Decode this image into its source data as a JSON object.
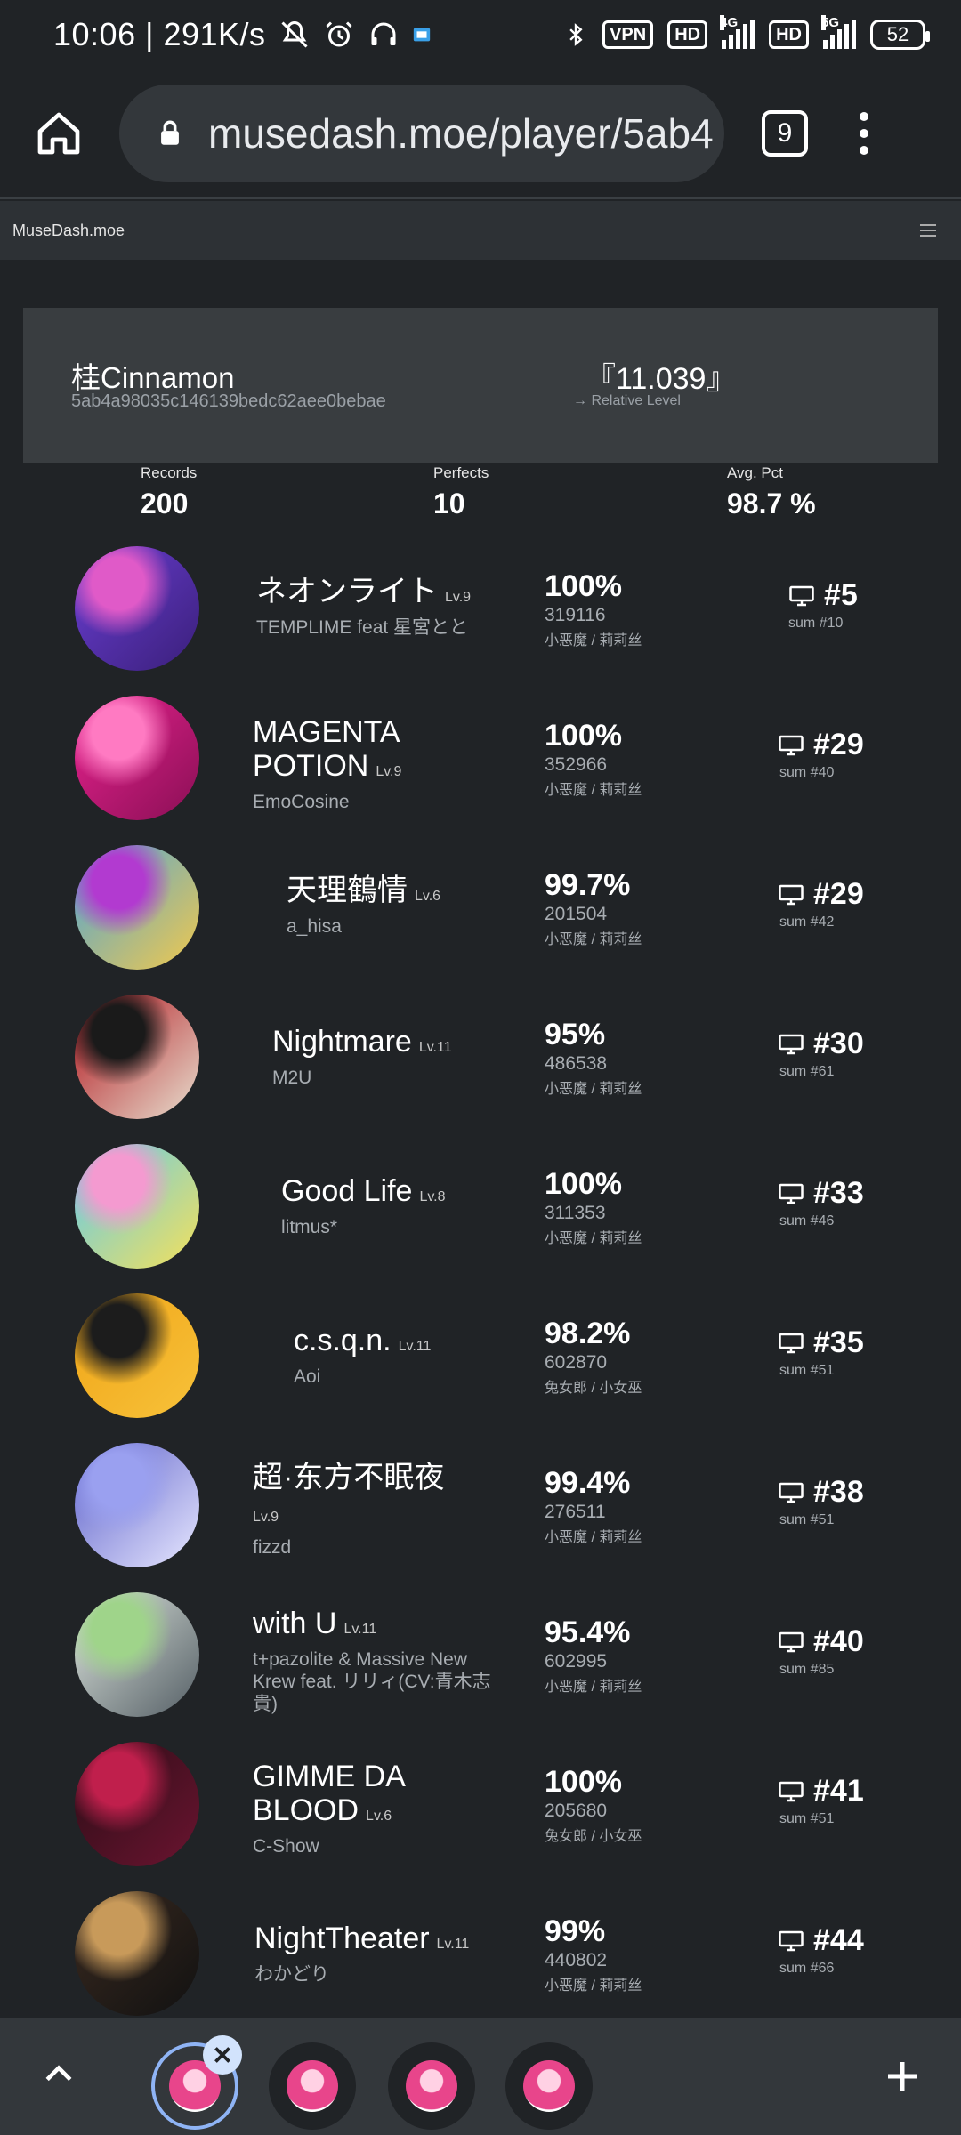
{
  "status_bar": {
    "time_speed": "10:06 | 291K/s",
    "vpn_label": "VPN",
    "hd_label": "HD",
    "net4g_label": "4G",
    "net5g_label": "5G",
    "battery_level": "52"
  },
  "browser": {
    "url": "musedash.moe/player/5ab4",
    "tab_count": "9"
  },
  "site": {
    "title": "MuseDash.moe"
  },
  "player": {
    "name": "桂Cinnamon",
    "id": "5ab4a98035c146139bedc62aee0bebae",
    "relative_level": "『11.039』",
    "relative_level_label": "→ Relative Level"
  },
  "stats": [
    {
      "label": "Records",
      "value": "200"
    },
    {
      "label": "Perfects",
      "value": "10"
    },
    {
      "label": "Avg. Pct",
      "value": "98.7 %"
    }
  ],
  "records": [
    {
      "title": "ネオンライト",
      "level": "Lv.9",
      "artist": "TEMPLIME feat 星宮とと",
      "pct": "100%",
      "score": "319116",
      "character": "小恶魔 / 莉莉丝",
      "rank": "#5",
      "sum": "sum #10",
      "cover_colors": [
        "#6b3fd4",
        "#e05ac8",
        "#3a1f7a"
      ]
    },
    {
      "title": "MAGENTA POTION",
      "level": "Lv.9",
      "artist": "EmoCosine",
      "pct": "100%",
      "score": "352966",
      "character": "小恶魔 / 莉莉丝",
      "rank": "#29",
      "sum": "sum #40",
      "cover_colors": [
        "#e8238f",
        "#ff7ac2",
        "#8a0f55"
      ]
    },
    {
      "title": "天理鶴情",
      "level": "Lv.6",
      "artist": "a_hisa",
      "pct": "99.7%",
      "score": "201504",
      "character": "小恶魔 / 莉莉丝",
      "rank": "#29",
      "sum": "sum #42",
      "cover_colors": [
        "#4ba3d9",
        "#b23ad0",
        "#f2c94c"
      ]
    },
    {
      "title": "Nightmare",
      "level": "Lv.11",
      "artist": "M2U",
      "pct": "95%",
      "score": "486538",
      "character": "小恶魔 / 莉莉丝",
      "rank": "#30",
      "sum": "sum #61",
      "cover_colors": [
        "#b0121b",
        "#1a1a1a",
        "#e8e0d0"
      ]
    },
    {
      "title": "Good Life",
      "level": "Lv.8",
      "artist": "litmus*",
      "pct": "100%",
      "score": "311353",
      "character": "小恶魔 / 莉莉丝",
      "rank": "#33",
      "sum": "sum #46",
      "cover_colors": [
        "#5ec9f0",
        "#f49ad0",
        "#f5e15a"
      ]
    },
    {
      "title": "c.s.q.n.",
      "level": "Lv.11",
      "artist": "Aoi",
      "pct": "98.2%",
      "score": "602870",
      "character": "兔女郎 / 小女巫",
      "rank": "#35",
      "sum": "sum #51",
      "cover_colors": [
        "#f0a417",
        "#1c1c1c",
        "#f7c23a"
      ]
    },
    {
      "title": "超·东方不眠夜",
      "level": "Lv.9",
      "artist": "fizzd",
      "pct": "99.4%",
      "score": "276511",
      "character": "小恶魔 / 莉莉丝",
      "rank": "#38",
      "sum": "sum #51",
      "cover_colors": [
        "#5b5fc9",
        "#9aa0f0",
        "#e8e8ff"
      ]
    },
    {
      "title": "with U",
      "level": "Lv.11",
      "artist": "t+pazolite & Massive New Krew feat. リリィ(CV:青木志貴)",
      "pct": "95.4%",
      "score": "602995",
      "character": "小恶魔 / 莉莉丝",
      "rank": "#40",
      "sum": "sum #85",
      "cover_colors": [
        "#dfe7df",
        "#9fd48a",
        "#555f66"
      ]
    },
    {
      "title": "GIMME DA BLOOD",
      "level": "Lv.6",
      "artist": "C-Show",
      "pct": "100%",
      "score": "205680",
      "character": "兔女郎 / 小女巫",
      "rank": "#41",
      "sum": "sum #51",
      "cover_colors": [
        "#2a0d16",
        "#c01f4c",
        "#6b1430"
      ]
    },
    {
      "title": "NightTheater",
      "level": "Lv.11",
      "artist": "わかどり",
      "pct": "99%",
      "score": "440802",
      "character": "小恶魔 / 莉莉丝",
      "rank": "#44",
      "sum": "sum #66",
      "cover_colors": [
        "#3a2a20",
        "#c89a5a",
        "#111111"
      ]
    }
  ]
}
